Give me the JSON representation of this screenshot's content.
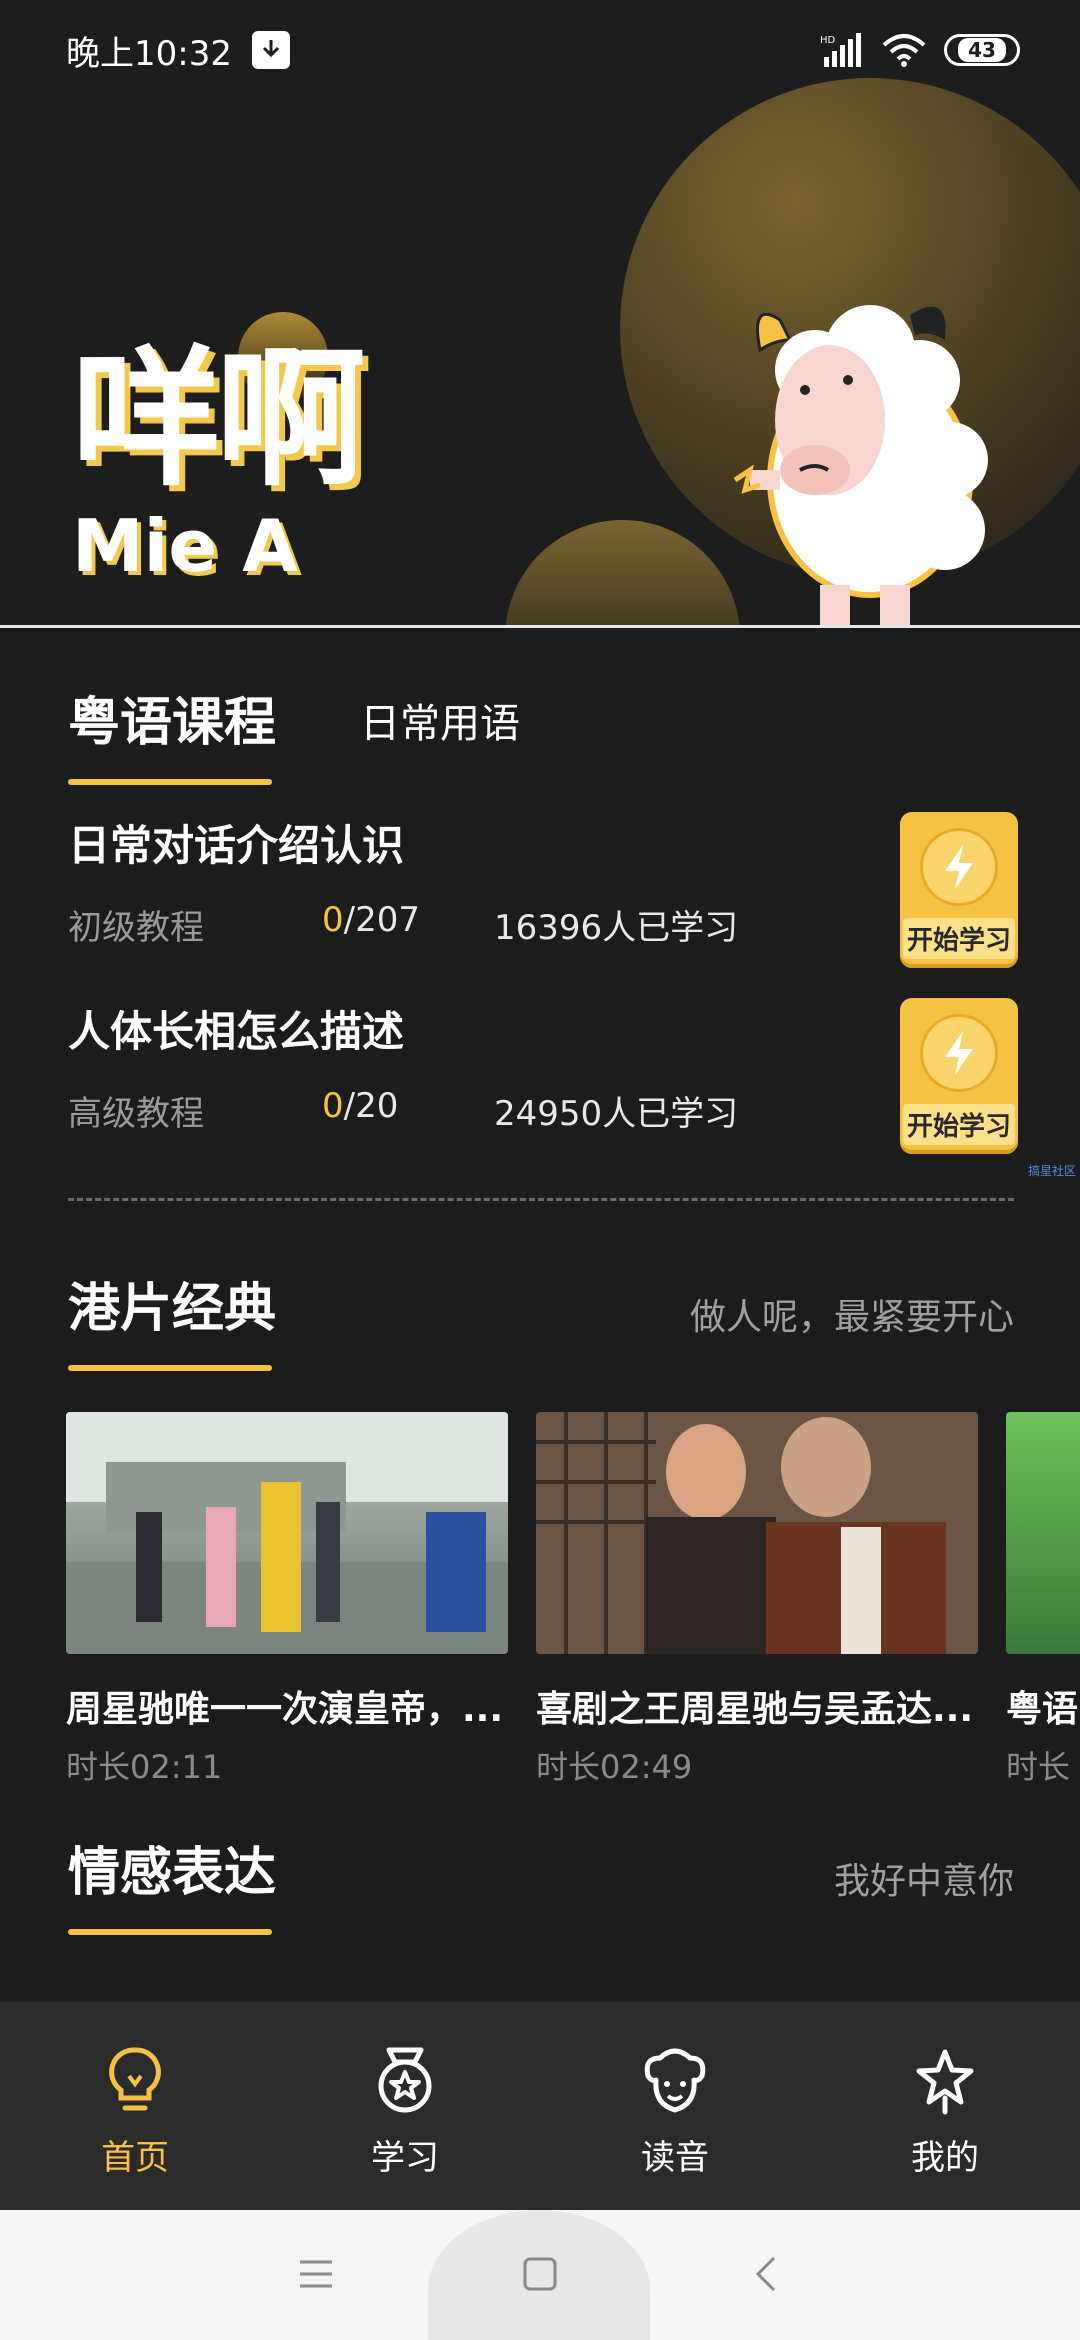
{
  "status_bar": {
    "time": "晚上10:32",
    "battery": "43",
    "hd": "HD"
  },
  "banner": {
    "logo_cn": "咩啊",
    "logo_en": "Mie A"
  },
  "tabs": [
    {
      "label": "粤语课程",
      "active": true
    },
    {
      "label": "日常用语",
      "active": false
    }
  ],
  "courses": [
    {
      "title": "日常对话介绍认识",
      "level": "初级教程",
      "progress_current": "0",
      "progress_total": "/207",
      "learners": "16396人已学习",
      "button": "开始学习"
    },
    {
      "title": "人体长相怎么描述",
      "level": "高级教程",
      "progress_current": "0",
      "progress_total": "/20",
      "learners": "24950人已学习",
      "button": "开始学习"
    }
  ],
  "watermark": "搞星社区",
  "section_movies": {
    "title": "港片经典",
    "subtitle": "做人呢，最紧要开心"
  },
  "videos": [
    {
      "title": "周星驰唯一一次演皇帝，...",
      "duration": "时长02:11"
    },
    {
      "title": "喜剧之王周星驰与吴孟达...",
      "duration": "时长02:49"
    },
    {
      "title": "粤语",
      "duration": "时长"
    }
  ],
  "section_emotion": {
    "title": "情感表达",
    "subtitle": "我好中意你"
  },
  "bottom_nav": [
    {
      "label": "首页",
      "icon": "lightbulb-icon",
      "active": true
    },
    {
      "label": "学习",
      "icon": "medal-icon",
      "active": false
    },
    {
      "label": "读音",
      "icon": "sheep-face-icon",
      "active": false
    },
    {
      "label": "我的",
      "icon": "star-icon",
      "active": false
    }
  ],
  "colors": {
    "accent": "#f5c243",
    "background": "#1c1c1c",
    "nav_bg": "#2b2b2b"
  }
}
